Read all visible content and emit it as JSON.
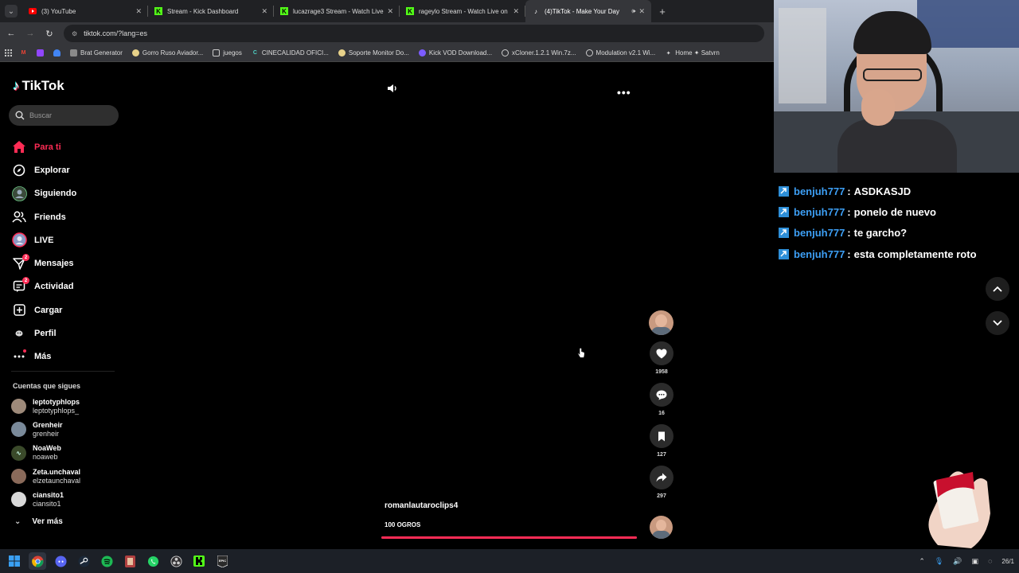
{
  "browser": {
    "tabs": [
      {
        "title": "(3) YouTube",
        "icon": "youtube-icon",
        "active": false
      },
      {
        "title": "Stream - Kick Dashboard",
        "icon": "kick-icon",
        "active": false
      },
      {
        "title": "lucazrage3 Stream - Watch Live",
        "icon": "kick-icon",
        "active": false
      },
      {
        "title": "rageylo Stream - Watch Live on",
        "icon": "kick-icon",
        "active": false
      },
      {
        "title": "(4)TikTok - Make Your Day",
        "icon": "tiktok-icon",
        "active": true
      }
    ],
    "url": "tiktok.com/?lang=es",
    "bookmarks": [
      {
        "label": "Brat Generator",
        "icon": "bookmark-brat-icon"
      },
      {
        "label": "Gorro Ruso Aviador...",
        "icon": "bookmark-hat-icon"
      },
      {
        "label": "juegos",
        "icon": "folder-icon"
      },
      {
        "label": "CINECALIDAD OFICI...",
        "icon": "bookmark-c-icon"
      },
      {
        "label": "Soporte Monitor Do...",
        "icon": "bookmark-monitor-icon"
      },
      {
        "label": "Kick VOD Download...",
        "icon": "bookmark-kick-icon"
      },
      {
        "label": "xCloner.1.2.1 Win.7z...",
        "icon": "bookmark-x-icon"
      },
      {
        "label": "Modulation v2.1 Wi...",
        "icon": "bookmark-mod-icon"
      },
      {
        "label": "Home ✦ Satvrn",
        "icon": "bookmark-star-icon"
      }
    ]
  },
  "tiktok": {
    "logo": "TikTok",
    "search_placeholder": "Buscar",
    "nav": [
      {
        "label": "Para ti",
        "icon": "home-icon",
        "active": true
      },
      {
        "label": "Explorar",
        "icon": "compass-icon"
      },
      {
        "label": "Siguiendo",
        "icon": "following-icon"
      },
      {
        "label": "Friends",
        "icon": "friends-icon"
      },
      {
        "label": "LIVE",
        "icon": "live-icon"
      },
      {
        "label": "Mensajes",
        "icon": "messages-icon",
        "badge": "2"
      },
      {
        "label": "Actividad",
        "icon": "activity-icon",
        "badge": "2"
      },
      {
        "label": "Cargar",
        "icon": "upload-icon"
      },
      {
        "label": "Perfil",
        "icon": "profile-icon"
      },
      {
        "label": "Más",
        "icon": "more-icon"
      }
    ],
    "following_title": "Cuentas que sigues",
    "following": [
      {
        "name": "leptotyphlops",
        "handle": "leptotyphlops_",
        "color": "#9e8a7a"
      },
      {
        "name": "Grenheir",
        "handle": "grenheir",
        "color": "#7a8a9a"
      },
      {
        "name": "NoaWeb",
        "handle": "noaweb",
        "color": "#3a4a2a"
      },
      {
        "name": "Zeta.unchaval",
        "handle": "elzetaunchaval",
        "color": "#8a6a5a"
      },
      {
        "name": "ciansito1",
        "handle": "ciansito1",
        "color": "#d9d9d9"
      }
    ],
    "see_more": "Ver más",
    "video": {
      "author": "romanlautaroclips4",
      "caption": "100 OGROS",
      "progress": 1.0,
      "likes": "1958",
      "comments": "16",
      "saves": "127",
      "shares": "297"
    }
  },
  "chat": {
    "messages": [
      {
        "user": "benjuh777",
        "text": "ASDKASJD"
      },
      {
        "user": "benjuh777",
        "text": "ponelo de nuevo"
      },
      {
        "user": "benjuh777",
        "text": "te garcho?"
      },
      {
        "user": "benjuh777",
        "text": "esta completamente roto"
      }
    ]
  },
  "taskbar": {
    "date": "26/1"
  },
  "colors": {
    "accent": "#fe2c55",
    "chat_user": "#3d9ff5",
    "kick_green": "#53fc18"
  }
}
